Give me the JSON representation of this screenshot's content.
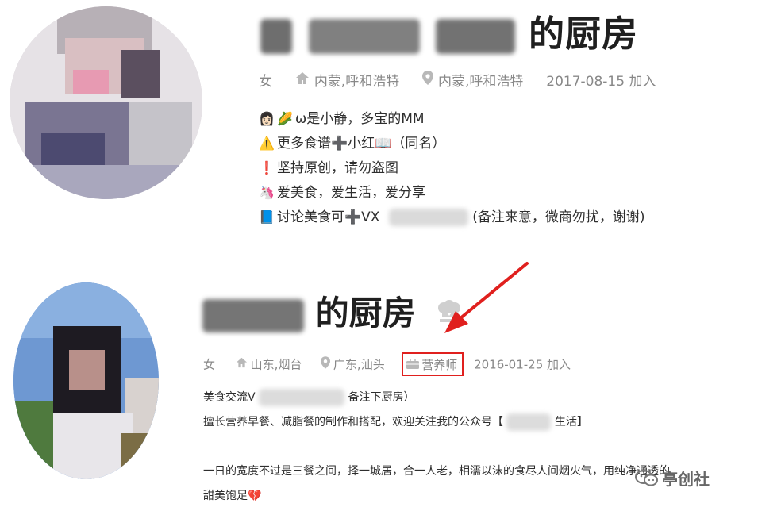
{
  "profile1": {
    "title": "的厨房",
    "gender": "女",
    "hometown": "内蒙,呼和浩特",
    "location": "内蒙,呼和浩特",
    "joined": "2017-08-15 加入",
    "bio": [
      {
        "icon": "woman-emoji-icon",
        "text": "ω是小静，多宝的MM"
      },
      {
        "icon": "warning-icon",
        "text": "更多食谱➕小红📖（同名）"
      },
      {
        "icon": "exclamation-icon",
        "text": "坚持原创，请勿盗图"
      },
      {
        "icon": "unicorn-icon",
        "text": "爱美食，爱生活，爱分享"
      },
      {
        "icon": "book-icon",
        "text": "讨论美食可➕VX",
        "suffix": "(备注来意，微商勿扰，谢谢)"
      }
    ]
  },
  "profile2": {
    "title": "的厨房",
    "gender": "女",
    "hometown": "山东,烟台",
    "location": "广东,汕头",
    "badge": "营养师",
    "joined": "2016-01-25 加入",
    "bio": [
      {
        "text": "美食交流V",
        "suffix": "备注下厨房）"
      },
      {
        "text": "擅长营养早餐、减脂餐的制作和搭配，欢迎关注我的公众号【",
        "suffix": "生活】"
      },
      {
        "text": ""
      },
      {
        "text": "一日的宽度不过是三餐之间，择一城居，合一人老，相濡以沫的食尽人间烟火气，用纯净通透的"
      },
      {
        "text": "甜美饱足💔"
      }
    ]
  },
  "watermark": "亭创社",
  "colors": {
    "highlight": "#e0201e",
    "meta_text": "#888888",
    "title_text": "#1f1f1f"
  }
}
